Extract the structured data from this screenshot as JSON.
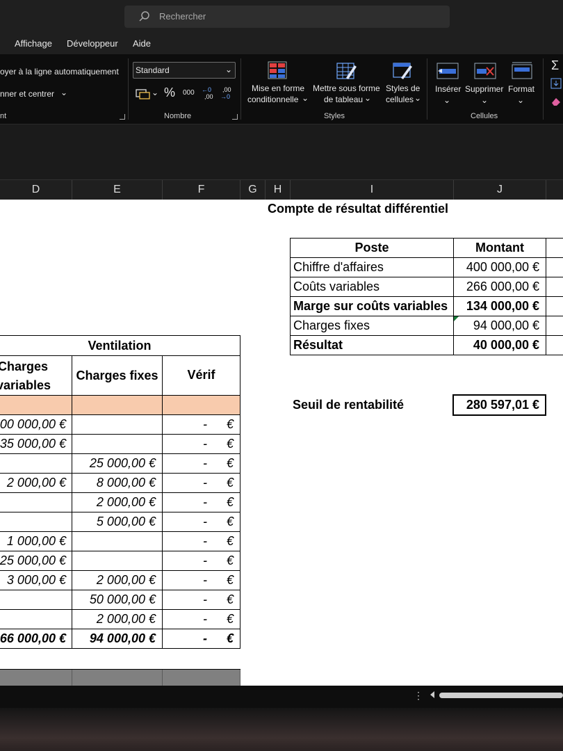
{
  "search": {
    "placeholder": "Rechercher"
  },
  "menu": [
    "Affichage",
    "Développeur",
    "Aide"
  ],
  "ribbon": {
    "alignment": {
      "wrap_text": "oyer à la ligne automatiquement",
      "merge_center": "nner et centrer",
      "group_label": "nt"
    },
    "number": {
      "format_value": "Standard",
      "percent": "%",
      "thousands": "000",
      "inc_decimal_top": "←0",
      "inc_decimal_bottom": ",00",
      "dec_decimal_top": ",00",
      "dec_decimal_bottom": "→0",
      "group_label": "Nombre"
    },
    "styles": {
      "conditional_l1": "Mise en forme",
      "conditional_l2": "conditionnelle",
      "table_l1": "Mettre sous forme",
      "table_l2": "de tableau",
      "cell_l1": "Styles de",
      "cell_l2": "cellules",
      "group_label": "Styles"
    },
    "cells": {
      "insert": "Insérer",
      "delete": "Supprimer",
      "format": "Format",
      "group_label": "Cellules"
    }
  },
  "columns": [
    "D",
    "E",
    "F",
    "G",
    "H",
    "I",
    "J"
  ],
  "ventilation": {
    "title": "Ventilation",
    "header_var_1": "Charges",
    "header_var_2": "variables",
    "header_fixed": "Charges fixes",
    "header_verif": "Vérif",
    "rows": [
      {
        "var": "00 000,00 €",
        "fixed": "",
        "verif": "-",
        "eur": "€"
      },
      {
        "var": "35 000,00 €",
        "fixed": "",
        "verif": "-",
        "eur": "€"
      },
      {
        "var": "",
        "fixed": "25 000,00 €",
        "verif": "-",
        "eur": "€"
      },
      {
        "var": "2 000,00 €",
        "fixed": "8 000,00 €",
        "verif": "-",
        "eur": "€"
      },
      {
        "var": "",
        "fixed": "2 000,00 €",
        "verif": "-",
        "eur": "€"
      },
      {
        "var": "",
        "fixed": "5 000,00 €",
        "verif": "-",
        "eur": "€"
      },
      {
        "var": "1 000,00 €",
        "fixed": "",
        "verif": "-",
        "eur": "€"
      },
      {
        "var": "25 000,00 €",
        "fixed": "",
        "verif": "-",
        "eur": "€"
      },
      {
        "var": "3 000,00 €",
        "fixed": "2 000,00 €",
        "verif": "-",
        "eur": "€"
      },
      {
        "var": "",
        "fixed": "50 000,00 €",
        "verif": "-",
        "eur": "€"
      },
      {
        "var": "",
        "fixed": "2 000,00 €",
        "verif": "-",
        "eur": "€"
      }
    ],
    "total": {
      "var": "66 000,00 €",
      "fixed": "94 000,00 €",
      "verif": "-",
      "eur": "€"
    }
  },
  "compte": {
    "title": "Compte de résultat différentiel",
    "header_poste": "Poste",
    "header_montant": "Montant",
    "rows": [
      {
        "poste": "Chiffre d'affaires",
        "montant": "400 000,00 €",
        "bold": false
      },
      {
        "poste": "Coûts variables",
        "montant": "266 000,00 €",
        "bold": false
      },
      {
        "poste": "Marge sur coûts variables",
        "montant": "134 000,00 €",
        "bold": true
      },
      {
        "poste": "Charges fixes",
        "montant": "94 000,00 €",
        "bold": false
      },
      {
        "poste": "Résultat",
        "montant": "40 000,00 €",
        "bold": true
      }
    ]
  },
  "seuil": {
    "label": "Seuil de rentabilité",
    "value": "280 597,01 €"
  }
}
